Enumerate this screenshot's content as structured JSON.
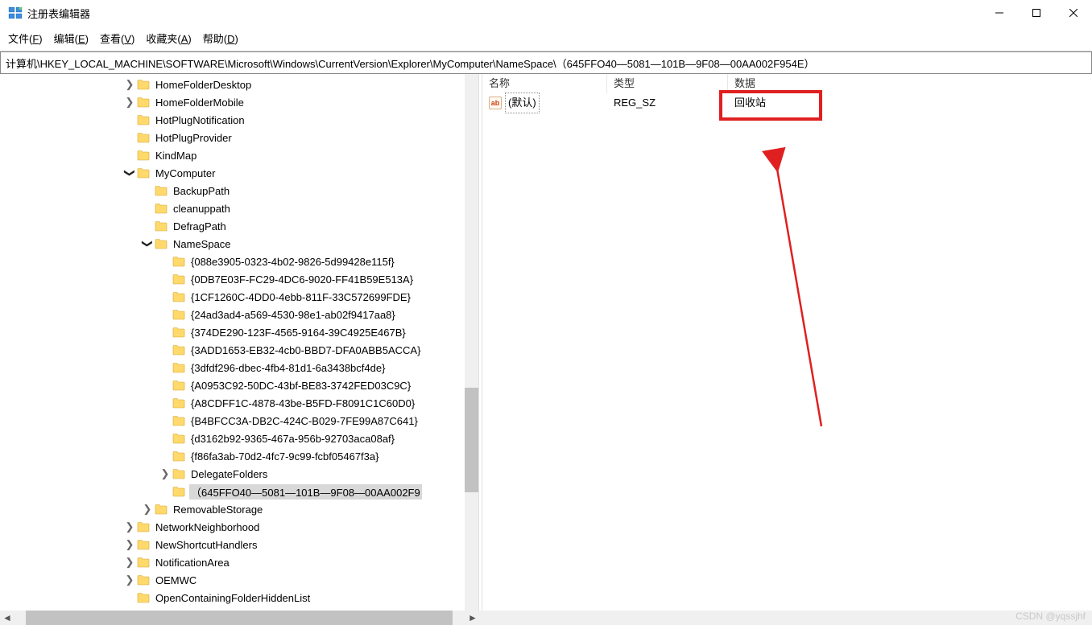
{
  "window": {
    "title": "注册表编辑器"
  },
  "menu": {
    "file": "文件(F)",
    "edit": "编辑(E)",
    "view": "查看(V)",
    "favorites": "收藏夹(A)",
    "help": "帮助(D)"
  },
  "address": "计算机\\HKEY_LOCAL_MACHINE\\SOFTWARE\\Microsoft\\Windows\\CurrentVersion\\Explorer\\MyComputer\\NameSpace\\（645FFO40—5081—101B—9F08—00AA002F954E）",
  "tree": {
    "items": [
      {
        "indent": 7,
        "exp": ">",
        "label": "HomeFolderDesktop"
      },
      {
        "indent": 7,
        "exp": ">",
        "label": "HomeFolderMobile"
      },
      {
        "indent": 7,
        "exp": "",
        "label": "HotPlugNotification"
      },
      {
        "indent": 7,
        "exp": "",
        "label": "HotPlugProvider"
      },
      {
        "indent": 7,
        "exp": "",
        "label": "KindMap"
      },
      {
        "indent": 7,
        "exp": "v",
        "label": "MyComputer"
      },
      {
        "indent": 8,
        "exp": "",
        "label": "BackupPath"
      },
      {
        "indent": 8,
        "exp": "",
        "label": "cleanuppath"
      },
      {
        "indent": 8,
        "exp": "",
        "label": "DefragPath"
      },
      {
        "indent": 8,
        "exp": "v",
        "label": "NameSpace"
      },
      {
        "indent": 9,
        "exp": "",
        "label": "{088e3905-0323-4b02-9826-5d99428e115f}"
      },
      {
        "indent": 9,
        "exp": "",
        "label": "{0DB7E03F-FC29-4DC6-9020-FF41B59E513A}"
      },
      {
        "indent": 9,
        "exp": "",
        "label": "{1CF1260C-4DD0-4ebb-811F-33C572699FDE}"
      },
      {
        "indent": 9,
        "exp": "",
        "label": "{24ad3ad4-a569-4530-98e1-ab02f9417aa8}"
      },
      {
        "indent": 9,
        "exp": "",
        "label": "{374DE290-123F-4565-9164-39C4925E467B}"
      },
      {
        "indent": 9,
        "exp": "",
        "label": "{3ADD1653-EB32-4cb0-BBD7-DFA0ABB5ACCA}"
      },
      {
        "indent": 9,
        "exp": "",
        "label": "{3dfdf296-dbec-4fb4-81d1-6a3438bcf4de}"
      },
      {
        "indent": 9,
        "exp": "",
        "label": "{A0953C92-50DC-43bf-BE83-3742FED03C9C}"
      },
      {
        "indent": 9,
        "exp": "",
        "label": "{A8CDFF1C-4878-43be-B5FD-F8091C1C60D0}"
      },
      {
        "indent": 9,
        "exp": "",
        "label": "{B4BFCC3A-DB2C-424C-B029-7FE99A87C641}"
      },
      {
        "indent": 9,
        "exp": "",
        "label": "{d3162b92-9365-467a-956b-92703aca08af}"
      },
      {
        "indent": 9,
        "exp": "",
        "label": "{f86fa3ab-70d2-4fc7-9c99-fcbf05467f3a}"
      },
      {
        "indent": 9,
        "exp": ">",
        "label": "DelegateFolders"
      },
      {
        "indent": 9,
        "exp": "",
        "label": "（645FFO40—5081—101B—9F08—00AA002F9",
        "selected": true
      },
      {
        "indent": 8,
        "exp": ">",
        "label": "RemovableStorage"
      },
      {
        "indent": 7,
        "exp": ">",
        "label": "NetworkNeighborhood"
      },
      {
        "indent": 7,
        "exp": ">",
        "label": "NewShortcutHandlers"
      },
      {
        "indent": 7,
        "exp": ">",
        "label": "NotificationArea"
      },
      {
        "indent": 7,
        "exp": ">",
        "label": "OEMWC"
      },
      {
        "indent": 7,
        "exp": "",
        "label": "OpenContainingFolderHiddenList"
      }
    ]
  },
  "values": {
    "headers": {
      "name": "名称",
      "type": "类型",
      "data": "数据"
    },
    "rows": [
      {
        "icon": "ab",
        "name": "(默认)",
        "type": "REG_SZ",
        "data": "回收站"
      }
    ]
  },
  "watermark": "CSDN @yqssjhf"
}
